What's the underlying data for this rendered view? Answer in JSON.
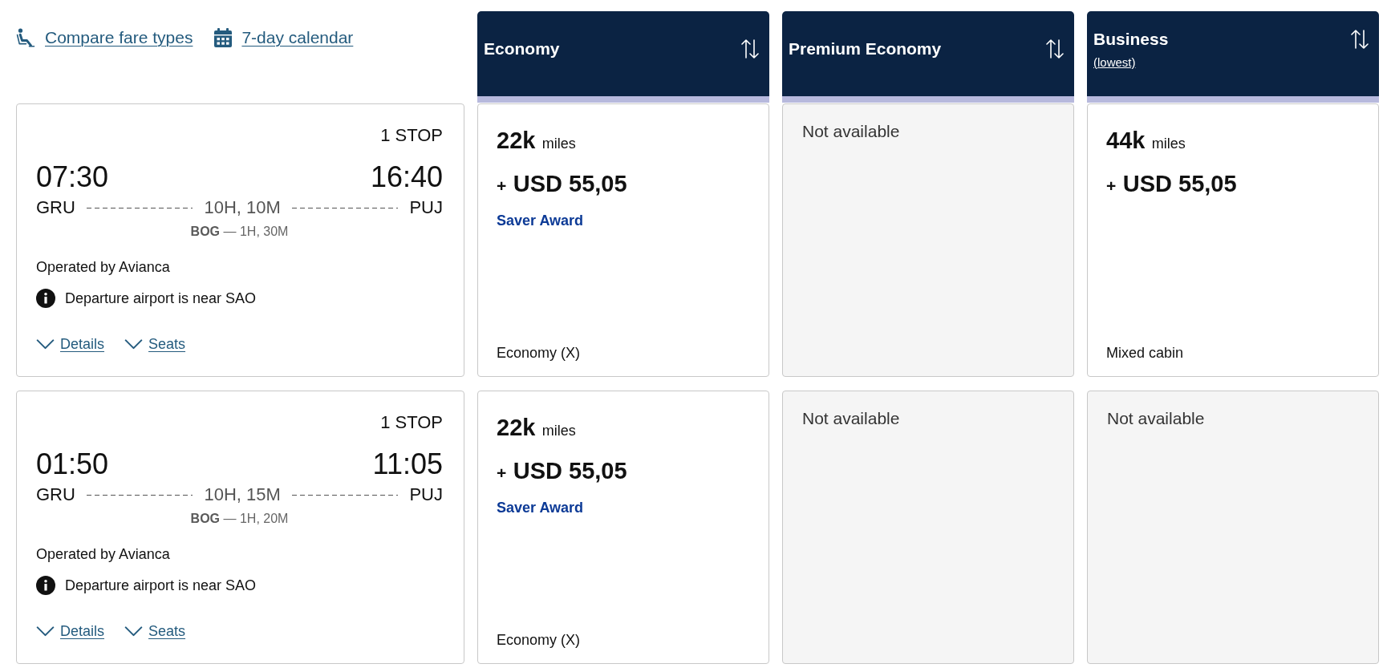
{
  "toolbar": {
    "links": [
      {
        "kind": "seat",
        "label": "Compare fare types"
      },
      {
        "kind": "calendar",
        "label": "7-day calendar"
      }
    ]
  },
  "cabins": [
    {
      "name": "Economy"
    },
    {
      "name": "Premium Economy"
    },
    {
      "name": "Business",
      "note": "(lowest)"
    }
  ],
  "flights": [
    {
      "stops": "1 STOP",
      "departure_time": "07:30",
      "arrival_time": "16:40",
      "origin": "GRU",
      "destination": "PUJ",
      "duration": "10H, 10M",
      "layover": "**BOG** — 1H, 30M",
      "operator": "Operated by Avianca",
      "notice": "Departure airport is near SAO",
      "actions": [
        "Details",
        "Seats"
      ],
      "fares": [
        {
          "kind": "award",
          "miles": "22k",
          "miles_unit": "miles",
          "price_prefix": "+",
          "price": "USD 55,05",
          "award_type": "Saver Award",
          "cabin": "Economy (X)"
        },
        {
          "kind": "unavailable",
          "message": "Not available"
        },
        {
          "kind": "award",
          "miles": "44k",
          "miles_unit": "miles",
          "price_prefix": "+",
          "price": "USD 55,05",
          "cabin": "Mixed cabin"
        }
      ]
    },
    {
      "stops": "1 STOP",
      "departure_time": "01:50",
      "arrival_time": "11:05",
      "origin": "GRU",
      "destination": "PUJ",
      "duration": "10H, 15M",
      "layover": "**BOG** — 1H, 20M",
      "operator": "Operated by Avianca",
      "notice": "Departure airport is near SAO",
      "actions": [
        "Details",
        "Seats"
      ],
      "fares": [
        {
          "kind": "award",
          "miles": "22k",
          "miles_unit": "miles",
          "price_prefix": "+",
          "price": "USD 55,05",
          "award_type": "Saver Award",
          "cabin": "Economy (X)"
        },
        {
          "kind": "unavailable",
          "message": "Not available"
        },
        {
          "kind": "unavailable",
          "message": "Not available"
        }
      ]
    }
  ]
}
